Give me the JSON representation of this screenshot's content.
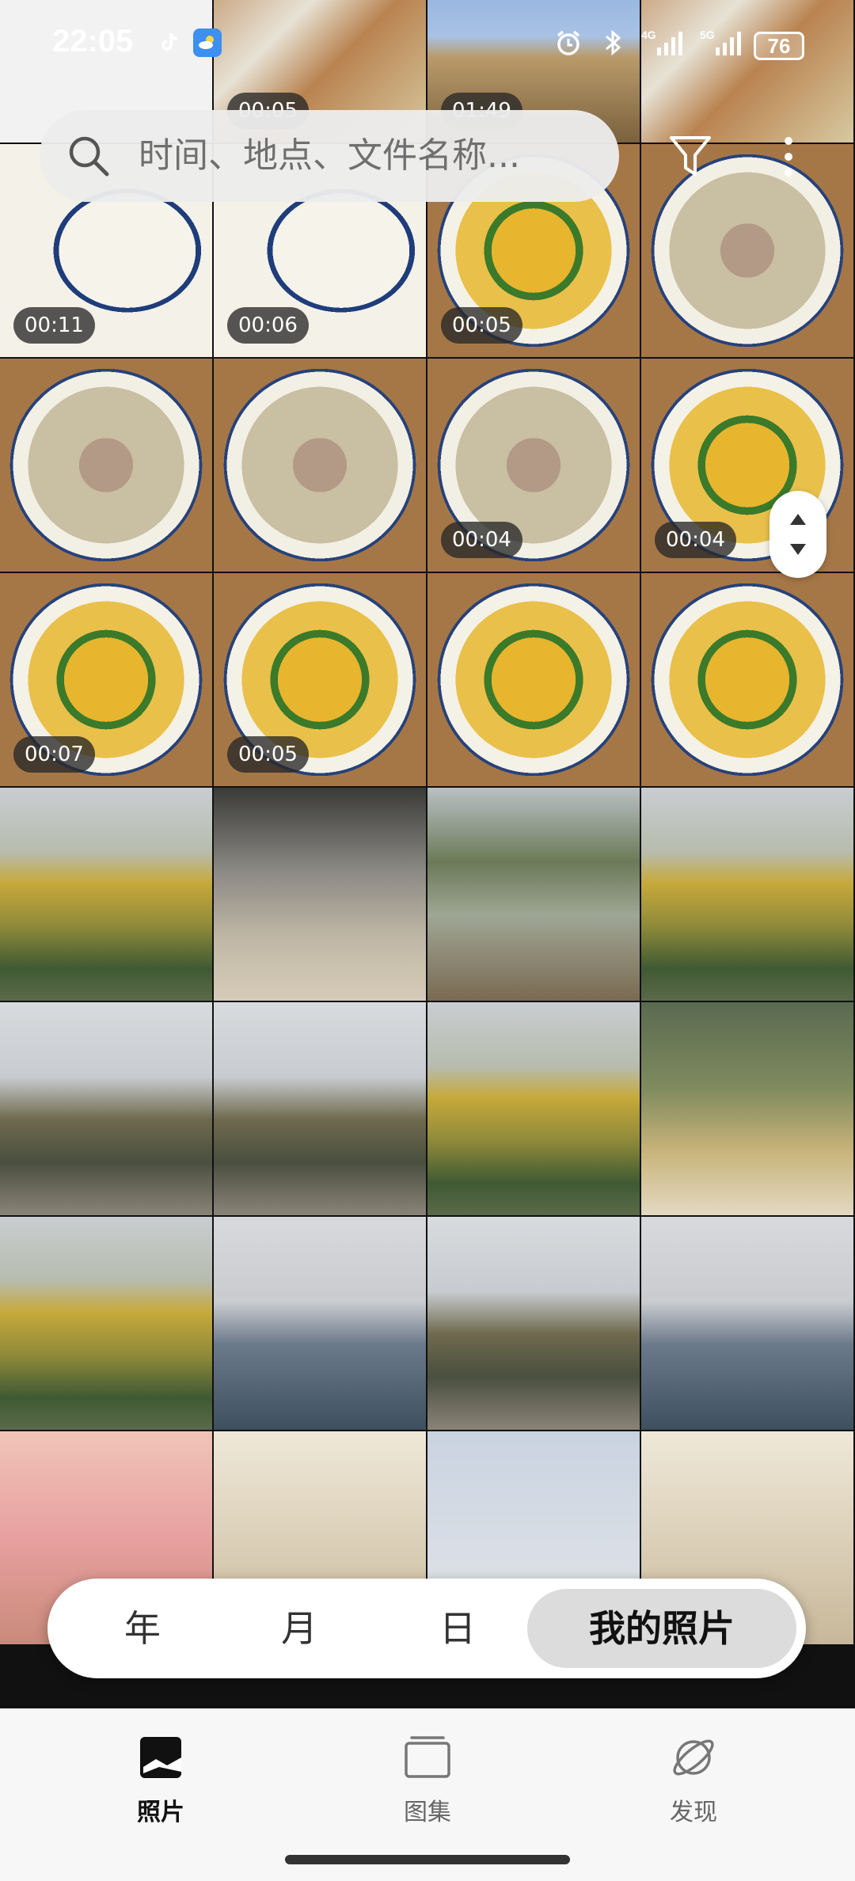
{
  "status_bar": {
    "time": "22:05",
    "signal_4g": "4G",
    "signal_5g": "5G",
    "battery": "76"
  },
  "search": {
    "placeholder": "时间、地点、文件名称..."
  },
  "thumbnails": [
    {
      "texture": "t-doc",
      "duration": ""
    },
    {
      "texture": "t-mixed",
      "duration": "00:05"
    },
    {
      "texture": "t-landscape",
      "duration": "01:49"
    },
    {
      "texture": "t-mixed",
      "duration": ""
    },
    {
      "texture": "t-wood",
      "duration": "00:11"
    },
    {
      "texture": "t-wood",
      "duration": "00:06"
    },
    {
      "texture": "t-plate-egg",
      "duration": "00:05"
    },
    {
      "texture": "t-beans",
      "duration": ""
    },
    {
      "texture": "t-beans",
      "duration": ""
    },
    {
      "texture": "t-beans",
      "duration": ""
    },
    {
      "texture": "t-beans",
      "duration": "00:04"
    },
    {
      "texture": "t-plate-egg",
      "duration": "00:04"
    },
    {
      "texture": "t-plate-egg",
      "duration": "00:07"
    },
    {
      "texture": "t-plate-egg",
      "duration": "00:05"
    },
    {
      "texture": "t-plate-egg",
      "duration": ""
    },
    {
      "texture": "t-plate-egg",
      "duration": ""
    },
    {
      "texture": "t-tree-yellow",
      "duration": ""
    },
    {
      "texture": "t-chicken",
      "duration": ""
    },
    {
      "texture": "t-pond",
      "duration": ""
    },
    {
      "texture": "t-tree-yellow",
      "duration": ""
    },
    {
      "texture": "t-tree-gray",
      "duration": ""
    },
    {
      "texture": "t-tree-gray",
      "duration": ""
    },
    {
      "texture": "t-tree-yellow",
      "duration": ""
    },
    {
      "texture": "t-road",
      "duration": ""
    },
    {
      "texture": "t-tree-yellow",
      "duration": ""
    },
    {
      "texture": "t-mountain",
      "duration": ""
    },
    {
      "texture": "t-tree-gray",
      "duration": ""
    },
    {
      "texture": "t-mountain",
      "duration": ""
    },
    {
      "texture": "t-sunset",
      "duration": ""
    },
    {
      "texture": "t-box",
      "duration": ""
    },
    {
      "texture": "t-sky",
      "duration": ""
    },
    {
      "texture": "t-box",
      "duration": ""
    }
  ],
  "segment": {
    "year": "年",
    "month": "月",
    "day": "日",
    "my_photos": "我的照片"
  },
  "bottom_nav": {
    "photos": "照片",
    "albums": "图集",
    "discover": "发现"
  }
}
